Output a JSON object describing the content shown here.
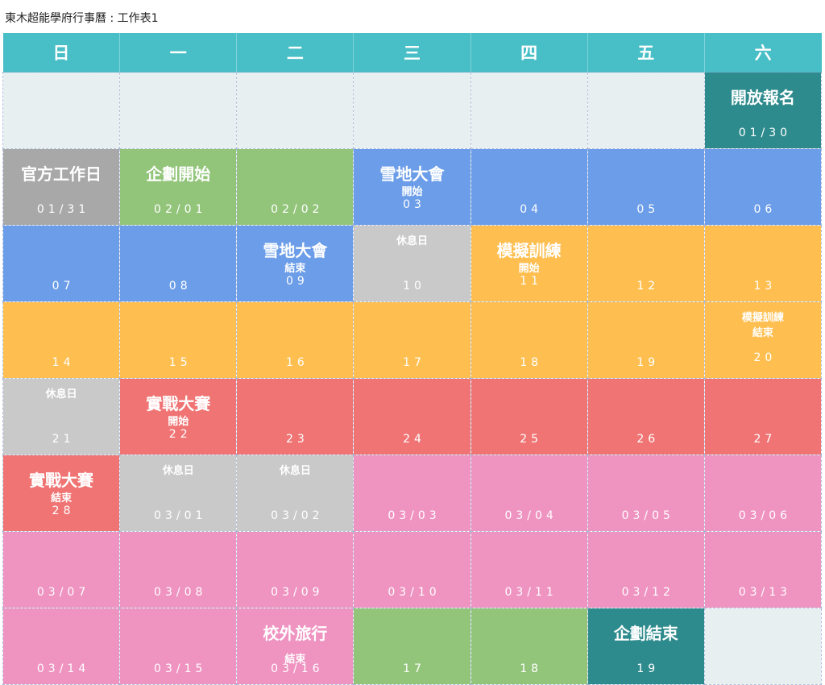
{
  "title": "東木超能學府行事曆 : 工作表1",
  "weekdays": [
    "日",
    "一",
    "二",
    "三",
    "四",
    "五",
    "六"
  ],
  "colors": {
    "header": "#48bec7",
    "empty": "#e7eff1",
    "teal": "#2e8b8d",
    "gray": "#a8a8a8",
    "light_gray": "#c9c9c9",
    "green": "#92c57a",
    "blue": "#6b9de8",
    "orange": "#ffbf50",
    "red": "#f07474",
    "pink": "#ef93c1"
  },
  "weeks": [
    {
      "days": [
        {
          "color": "empty"
        },
        {
          "color": "empty"
        },
        {
          "color": "empty"
        },
        {
          "color": "empty"
        },
        {
          "color": "empty"
        },
        {
          "color": "empty"
        },
        {
          "color": "teal",
          "event": "開放報名",
          "date": "01/30"
        }
      ]
    },
    {
      "days": [
        {
          "color": "gray",
          "event": "官方工作日",
          "date": "01/31"
        },
        {
          "color": "green",
          "event": "企劃開始",
          "date": "02/01"
        },
        {
          "color": "green",
          "date": "02/02"
        },
        {
          "color": "blue",
          "event": "雪地大會",
          "sub": "開始",
          "date": "03"
        },
        {
          "color": "blue",
          "date": "04"
        },
        {
          "color": "blue",
          "date": "05"
        },
        {
          "color": "blue",
          "date": "06"
        }
      ]
    },
    {
      "days": [
        {
          "color": "blue",
          "date": "07"
        },
        {
          "color": "blue",
          "date": "08"
        },
        {
          "color": "blue",
          "event": "雪地大會",
          "sub": "結束",
          "date": "09"
        },
        {
          "color": "light_gray",
          "small_event": "休息日",
          "date": "10"
        },
        {
          "color": "orange",
          "event": "模擬訓練",
          "sub": "開始",
          "date": "11"
        },
        {
          "color": "orange",
          "date": "12"
        },
        {
          "color": "orange",
          "date": "13"
        }
      ]
    },
    {
      "days": [
        {
          "color": "orange",
          "date": "14"
        },
        {
          "color": "orange",
          "date": "15"
        },
        {
          "color": "orange",
          "date": "16"
        },
        {
          "color": "orange",
          "date": "17"
        },
        {
          "color": "orange",
          "date": "18"
        },
        {
          "color": "orange",
          "date": "19"
        },
        {
          "color": "orange",
          "small_event": "模擬訓練",
          "sub": "結束",
          "date": "20"
        }
      ]
    },
    {
      "days": [
        {
          "color": "light_gray",
          "small_event": "休息日",
          "date": "21"
        },
        {
          "color": "red",
          "event": "實戰大賽",
          "sub": "開始",
          "date": "22"
        },
        {
          "color": "red",
          "date": "23"
        },
        {
          "color": "red",
          "date": "24"
        },
        {
          "color": "red",
          "date": "25"
        },
        {
          "color": "red",
          "date": "26"
        },
        {
          "color": "red",
          "date": "27"
        }
      ]
    },
    {
      "days": [
        {
          "color": "red",
          "event": "實戰大賽",
          "sub": "結束",
          "date": "28"
        },
        {
          "color": "light_gray",
          "small_event": "休息日",
          "date": "03/01"
        },
        {
          "color": "light_gray",
          "small_event": "休息日",
          "date": "03/02"
        },
        {
          "color": "pink",
          "date": "03/03"
        },
        {
          "color": "pink",
          "date": "03/04"
        },
        {
          "color": "pink",
          "date": "03/05"
        },
        {
          "color": "pink",
          "date": "03/06"
        }
      ]
    },
    {
      "days": [
        {
          "color": "pink",
          "date": "03/07"
        },
        {
          "color": "pink",
          "date": "03/08"
        },
        {
          "color": "pink",
          "date": "03/09"
        },
        {
          "color": "pink",
          "date": "03/10"
        },
        {
          "color": "pink",
          "date": "03/11"
        },
        {
          "color": "pink",
          "date": "03/12"
        },
        {
          "color": "pink",
          "date": "03/13"
        }
      ]
    },
    {
      "days": [
        {
          "color": "pink",
          "date": "03/14"
        },
        {
          "color": "pink",
          "date": "03/15"
        },
        {
          "color": "pink",
          "event": "校外旅行",
          "sub": "結束",
          "date": "03/16"
        },
        {
          "color": "green",
          "date": "17"
        },
        {
          "color": "green",
          "date": "18"
        },
        {
          "color": "teal",
          "event": "企劃結束",
          "date": "19"
        },
        {
          "color": "empty"
        }
      ]
    }
  ]
}
